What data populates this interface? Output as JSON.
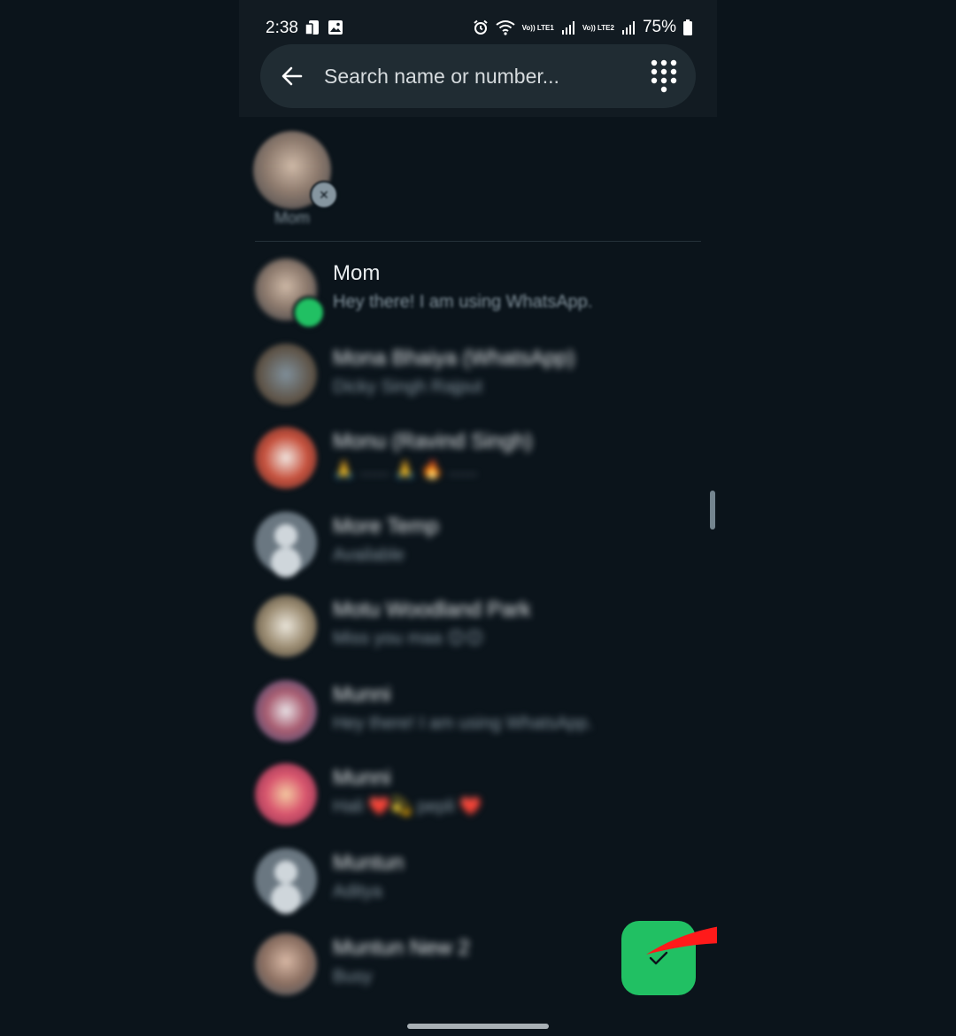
{
  "status_bar": {
    "time": "2:38",
    "battery": "75%",
    "sim1_label": "Vo)) LTE1",
    "sim2_label": "Vo)) LTE2"
  },
  "search": {
    "placeholder": "Search name or number..."
  },
  "selected": [
    {
      "label": "Mom"
    }
  ],
  "contacts": [
    {
      "name": "Mom",
      "status": "Hey there! I am using WhatsApp.",
      "selected": true
    },
    {
      "name": "Mona Bhaiya (WhatsApp)",
      "status": "Dicky Singh Rajput"
    },
    {
      "name": "Monu (Ravind Singh)",
      "status": "🙏 ...... 🙏 🔥 ......"
    },
    {
      "name": "More Temp",
      "status": "Available"
    },
    {
      "name": "Motu Woodland Park",
      "status": "Miss you maa 😊😊"
    },
    {
      "name": "Munni",
      "status": "Hey there! I am using WhatsApp."
    },
    {
      "name": "Munni",
      "status": "Hali ❤️💫 pepli ❤️"
    },
    {
      "name": "Muntun",
      "status": "Aditya"
    },
    {
      "name": "Muntun New 2",
      "status": "Busy"
    }
  ],
  "colors": {
    "accent_green": "#21c063",
    "background": "#0b141b",
    "header": "#121b22",
    "search_bg": "#202c33",
    "arrow_red": "#ff1a1a"
  },
  "icons": {
    "back": "arrow-left-icon",
    "dialpad": "dialpad-icon",
    "fab": "check-icon",
    "chip_remove": "close-icon"
  }
}
